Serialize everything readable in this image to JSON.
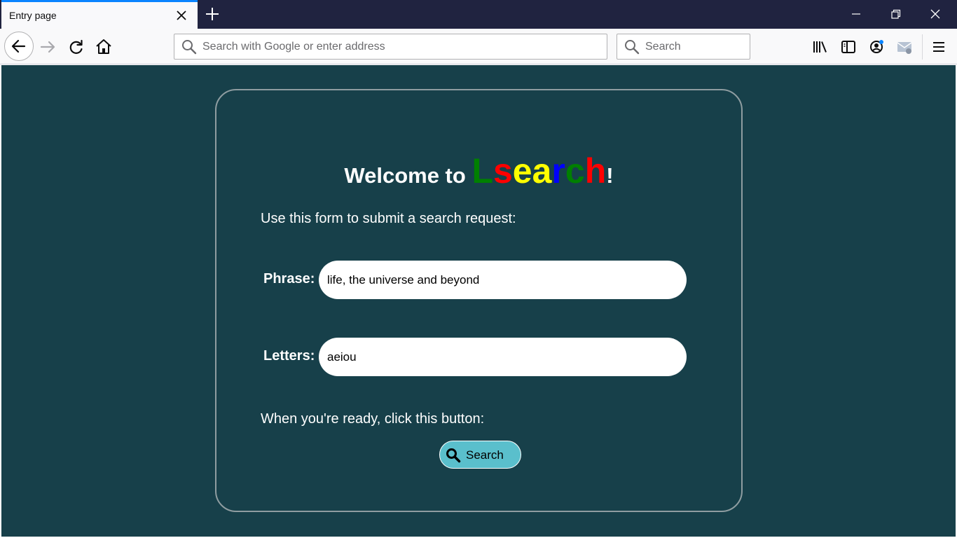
{
  "browser": {
    "tab": {
      "title": "Entry page"
    },
    "urlbar": {
      "placeholder": "Search with Google or enter address"
    },
    "searchbar": {
      "placeholder": "Search"
    }
  },
  "page": {
    "welcome_prefix": "Welcome to ",
    "brand_letters": [
      {
        "char": "L",
        "color": "#008000"
      },
      {
        "char": "s",
        "color": "#ff0000"
      },
      {
        "char": "e",
        "color": "#ffff00"
      },
      {
        "char": "a",
        "color": "#ffff00"
      },
      {
        "char": "r",
        "color": "#0000ff"
      },
      {
        "char": "c",
        "color": "#008000"
      },
      {
        "char": "h",
        "color": "#ff0000"
      }
    ],
    "welcome_suffix": "!",
    "intro": "Use this form to submit a search request:",
    "phrase": {
      "label": "Phrase:",
      "value": "life, the universe and beyond"
    },
    "letters": {
      "label": "Letters:",
      "value": "aeiou"
    },
    "ready_text": "When you're ready, click this button:",
    "submit_label": "Search"
  },
  "colors": {
    "page_bg": "#17404a",
    "button_bg": "#5abfcc",
    "tab_accent": "#0a84ff",
    "titlebar_bg": "#202340"
  }
}
